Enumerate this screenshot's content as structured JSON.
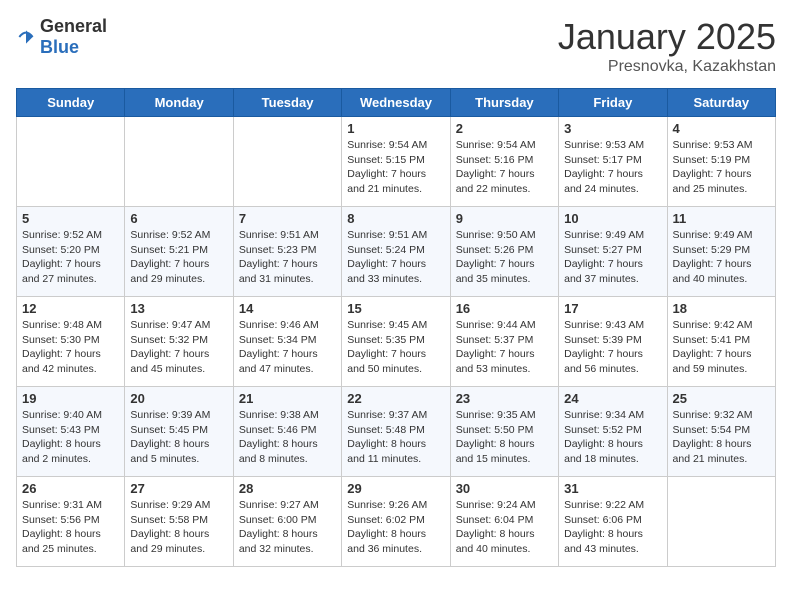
{
  "header": {
    "logo": {
      "general": "General",
      "blue": "Blue"
    },
    "title": "January 2025",
    "subtitle": "Presnovka, Kazakhstan"
  },
  "weekdays": [
    "Sunday",
    "Monday",
    "Tuesday",
    "Wednesday",
    "Thursday",
    "Friday",
    "Saturday"
  ],
  "weeks": [
    [
      {
        "day": "",
        "info": ""
      },
      {
        "day": "",
        "info": ""
      },
      {
        "day": "",
        "info": ""
      },
      {
        "day": "1",
        "info": "Sunrise: 9:54 AM\nSunset: 5:15 PM\nDaylight: 7 hours and 21 minutes."
      },
      {
        "day": "2",
        "info": "Sunrise: 9:54 AM\nSunset: 5:16 PM\nDaylight: 7 hours and 22 minutes."
      },
      {
        "day": "3",
        "info": "Sunrise: 9:53 AM\nSunset: 5:17 PM\nDaylight: 7 hours and 24 minutes."
      },
      {
        "day": "4",
        "info": "Sunrise: 9:53 AM\nSunset: 5:19 PM\nDaylight: 7 hours and 25 minutes."
      }
    ],
    [
      {
        "day": "5",
        "info": "Sunrise: 9:52 AM\nSunset: 5:20 PM\nDaylight: 7 hours and 27 minutes."
      },
      {
        "day": "6",
        "info": "Sunrise: 9:52 AM\nSunset: 5:21 PM\nDaylight: 7 hours and 29 minutes."
      },
      {
        "day": "7",
        "info": "Sunrise: 9:51 AM\nSunset: 5:23 PM\nDaylight: 7 hours and 31 minutes."
      },
      {
        "day": "8",
        "info": "Sunrise: 9:51 AM\nSunset: 5:24 PM\nDaylight: 7 hours and 33 minutes."
      },
      {
        "day": "9",
        "info": "Sunrise: 9:50 AM\nSunset: 5:26 PM\nDaylight: 7 hours and 35 minutes."
      },
      {
        "day": "10",
        "info": "Sunrise: 9:49 AM\nSunset: 5:27 PM\nDaylight: 7 hours and 37 minutes."
      },
      {
        "day": "11",
        "info": "Sunrise: 9:49 AM\nSunset: 5:29 PM\nDaylight: 7 hours and 40 minutes."
      }
    ],
    [
      {
        "day": "12",
        "info": "Sunrise: 9:48 AM\nSunset: 5:30 PM\nDaylight: 7 hours and 42 minutes."
      },
      {
        "day": "13",
        "info": "Sunrise: 9:47 AM\nSunset: 5:32 PM\nDaylight: 7 hours and 45 minutes."
      },
      {
        "day": "14",
        "info": "Sunrise: 9:46 AM\nSunset: 5:34 PM\nDaylight: 7 hours and 47 minutes."
      },
      {
        "day": "15",
        "info": "Sunrise: 9:45 AM\nSunset: 5:35 PM\nDaylight: 7 hours and 50 minutes."
      },
      {
        "day": "16",
        "info": "Sunrise: 9:44 AM\nSunset: 5:37 PM\nDaylight: 7 hours and 53 minutes."
      },
      {
        "day": "17",
        "info": "Sunrise: 9:43 AM\nSunset: 5:39 PM\nDaylight: 7 hours and 56 minutes."
      },
      {
        "day": "18",
        "info": "Sunrise: 9:42 AM\nSunset: 5:41 PM\nDaylight: 7 hours and 59 minutes."
      }
    ],
    [
      {
        "day": "19",
        "info": "Sunrise: 9:40 AM\nSunset: 5:43 PM\nDaylight: 8 hours and 2 minutes."
      },
      {
        "day": "20",
        "info": "Sunrise: 9:39 AM\nSunset: 5:45 PM\nDaylight: 8 hours and 5 minutes."
      },
      {
        "day": "21",
        "info": "Sunrise: 9:38 AM\nSunset: 5:46 PM\nDaylight: 8 hours and 8 minutes."
      },
      {
        "day": "22",
        "info": "Sunrise: 9:37 AM\nSunset: 5:48 PM\nDaylight: 8 hours and 11 minutes."
      },
      {
        "day": "23",
        "info": "Sunrise: 9:35 AM\nSunset: 5:50 PM\nDaylight: 8 hours and 15 minutes."
      },
      {
        "day": "24",
        "info": "Sunrise: 9:34 AM\nSunset: 5:52 PM\nDaylight: 8 hours and 18 minutes."
      },
      {
        "day": "25",
        "info": "Sunrise: 9:32 AM\nSunset: 5:54 PM\nDaylight: 8 hours and 21 minutes."
      }
    ],
    [
      {
        "day": "26",
        "info": "Sunrise: 9:31 AM\nSunset: 5:56 PM\nDaylight: 8 hours and 25 minutes."
      },
      {
        "day": "27",
        "info": "Sunrise: 9:29 AM\nSunset: 5:58 PM\nDaylight: 8 hours and 29 minutes."
      },
      {
        "day": "28",
        "info": "Sunrise: 9:27 AM\nSunset: 6:00 PM\nDaylight: 8 hours and 32 minutes."
      },
      {
        "day": "29",
        "info": "Sunrise: 9:26 AM\nSunset: 6:02 PM\nDaylight: 8 hours and 36 minutes."
      },
      {
        "day": "30",
        "info": "Sunrise: 9:24 AM\nSunset: 6:04 PM\nDaylight: 8 hours and 40 minutes."
      },
      {
        "day": "31",
        "info": "Sunrise: 9:22 AM\nSunset: 6:06 PM\nDaylight: 8 hours and 43 minutes."
      },
      {
        "day": "",
        "info": ""
      }
    ]
  ]
}
